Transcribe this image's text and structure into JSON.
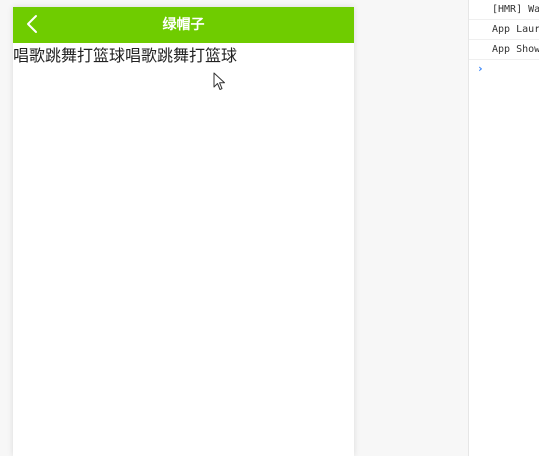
{
  "navbar": {
    "title": "绿帽子",
    "background": "#6fcc00",
    "back_icon": "chevron-left-icon"
  },
  "content": {
    "text": "唱歌跳舞打篮球唱歌跳舞打篮球"
  },
  "console": {
    "lines": [
      "[HMR] Wa",
      "App Laur",
      "App Show"
    ],
    "prompt": "›",
    "prompt_color": "#2d7ff9"
  }
}
